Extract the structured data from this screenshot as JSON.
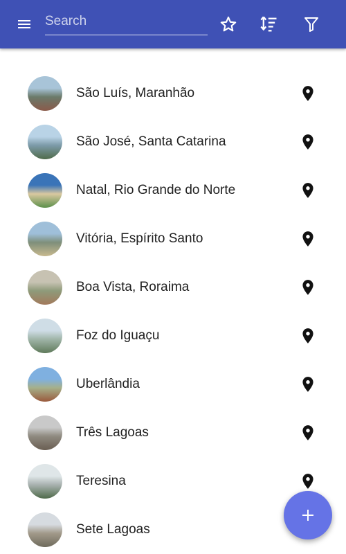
{
  "appbar": {
    "color": "#3f51b5",
    "search_placeholder": "Search",
    "search_value": "",
    "icons": [
      "menu-icon",
      "star-outline-icon",
      "sort-icon",
      "filter-icon"
    ]
  },
  "cities": [
    {
      "name": "São Luís, Maranhão",
      "thumb": [
        "#a8c4d8",
        "#6b7a6a",
        "#8a5a4a"
      ]
    },
    {
      "name": "São José, Santa Catarina",
      "thumb": [
        "#b9d3e6",
        "#7c9aa8",
        "#4f6b4a"
      ]
    },
    {
      "name": "Natal, Rio Grande do Norte",
      "thumb": [
        "#3a74b8",
        "#d9c8a0",
        "#5c8f4a"
      ]
    },
    {
      "name": "Vitória, Espírito Santo",
      "thumb": [
        "#9fbfd9",
        "#7e8f7a",
        "#c8b98e"
      ]
    },
    {
      "name": "Boa Vista, Roraima",
      "thumb": [
        "#c7c2b2",
        "#8e9a7a",
        "#a27a5c"
      ]
    },
    {
      "name": "Foz do Iguaçu",
      "thumb": [
        "#cfdde6",
        "#9fb4a8",
        "#5f7a5a"
      ]
    },
    {
      "name": "Uberlândia",
      "thumb": [
        "#7fb0e0",
        "#a6b08a",
        "#9a5a3c"
      ]
    },
    {
      "name": "Três Lagoas",
      "thumb": [
        "#c9c9c9",
        "#8f8a80",
        "#6a5e52"
      ]
    },
    {
      "name": "Teresina",
      "thumb": [
        "#dfe6e8",
        "#a9b2b0",
        "#4f6a4a"
      ]
    },
    {
      "name": "Sete Lagoas",
      "thumb": [
        "#d6dbe0",
        "#a29a8a",
        "#6e6a5c"
      ]
    }
  ],
  "fab": {
    "icon": "add-icon",
    "color": "#6573e6"
  }
}
